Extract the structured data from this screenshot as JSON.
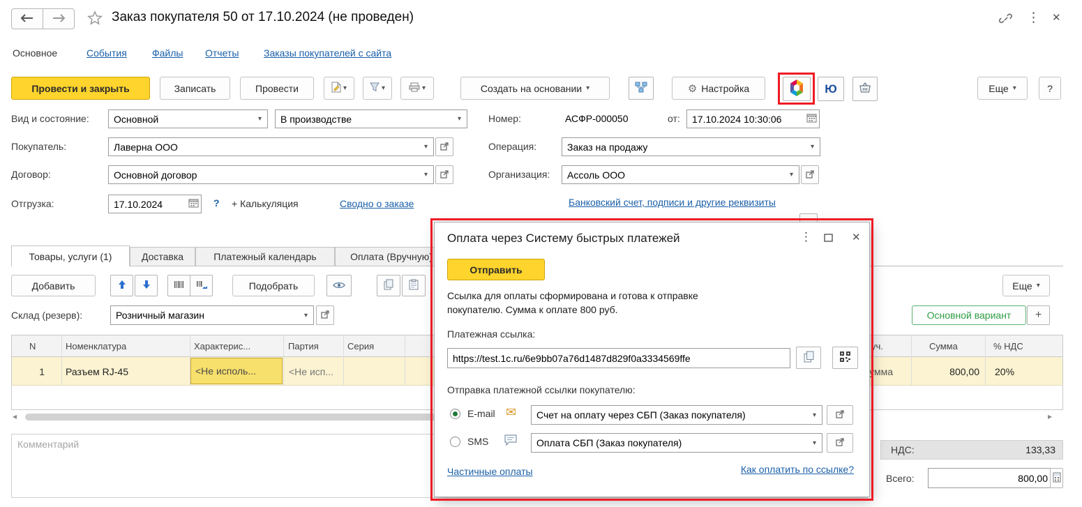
{
  "window": {
    "title": "Заказ покупателя 50 от 17.10.2024 (не проведен)"
  },
  "colors": {
    "accent_yellow": "#ffd42c",
    "link_blue": "#1a5fa8",
    "highlight_red": "#ee1b24",
    "variant_green": "#2f9e44",
    "row_highlight": "#fbf3d1",
    "cell_highlight": "#f7e06b"
  },
  "icons": {
    "gear": "⚙",
    "envelope": "✉",
    "kebab": "⋮",
    "close": "✕",
    "dropdown": "▾",
    "scroll_left": "◂",
    "scroll_right": "▸",
    "maximize": "▢",
    "star": "☆",
    "plus": "+"
  },
  "nav": {
    "items": [
      {
        "label": "Основное"
      },
      {
        "label": "События"
      },
      {
        "label": "Файлы"
      },
      {
        "label": "Отчеты"
      },
      {
        "label": "Заказы покупателей с сайта"
      }
    ]
  },
  "toolbar": {
    "post_close": "Провести и закрыть",
    "write": "Записать",
    "post": "Провести",
    "create_base": "Создать на основании",
    "settings": "Настройка",
    "yookassa": "Ю",
    "more": "Еще",
    "help": "?"
  },
  "form": {
    "kind_label": "Вид и состояние:",
    "kind": "Основной",
    "state": "В производстве",
    "buyer_label": "Покупатель:",
    "buyer": "Лаверна ООО",
    "contract_label": "Договор:",
    "contract": "Основной договор",
    "ship_label": "Отгрузка:",
    "ship_date": "17.10.2024",
    "ship_help": "?",
    "calc": "+ Калькуляция",
    "summary_link": "Сводно о заказе",
    "num_label": "Номер:",
    "num": "АСФР-000050",
    "from_label": "от:",
    "datetime": "17.10.2024 10:30:06",
    "op_label": "Операция:",
    "op": "Заказ на продажу",
    "org_label": "Организация:",
    "org": "Ассоль ООО",
    "bank_link": "Банковский счет, подписи и другие реквизиты"
  },
  "tabs": {
    "goods": "Товары, услуги (1)",
    "delivery": "Доставка",
    "calendar": "Платежный календарь",
    "payment": "Оплата (Вручную)"
  },
  "grid_toolbar": {
    "add": "Добавить",
    "pick": "Подобрать",
    "more": "Еще",
    "warehouse_label": "Склад (резерв):",
    "warehouse": "Розничный магазин",
    "variant": "Основной вариант",
    "plus": "+"
  },
  "grid": {
    "headers": {
      "n": "N",
      "item": "Номенклатура",
      "characteristic": "Характерис...",
      "batch": "Партия",
      "series": "Серия",
      "partial": "уч.",
      "sum": "Сумма",
      "vat": "% НДС"
    },
    "row": {
      "n": "1",
      "item": "Разъем RJ-45",
      "characteristic": "<Не исполь...",
      "batch": "<Не исп...",
      "hidden_fragment": "Сумма",
      "sum": "800,00",
      "vat": "20%"
    }
  },
  "footer": {
    "comment_placeholder": "Комментарий",
    "vat_label": "НДС:",
    "vat_value": "133,33",
    "total_label": "Всего:",
    "total_value": "800,00"
  },
  "dialog": {
    "title": "Оплата через Систему быстрых платежей",
    "send": "Отправить",
    "info_line1": "Ссылка для оплаты сформирована и готова к отправке",
    "info_line2": "покупателю. Сумма к оплате 800 руб.",
    "link_label": "Платежная ссылка:",
    "link_value": "https://test.1c.ru/6e9bb07a76d1487d829f0a3334569ffe",
    "send_section_label": "Отправка платежной ссылки покупателю:",
    "email_option": "E-mail",
    "email_template": "Счет на оплату через СБП (Заказ покупателя)",
    "sms_option": "SMS",
    "sms_template": "Оплата СБП (Заказ покупателя)",
    "partial_payments_link": "Частичные оплаты",
    "how_to_pay_link": "Как оплатить по ссылке?"
  }
}
